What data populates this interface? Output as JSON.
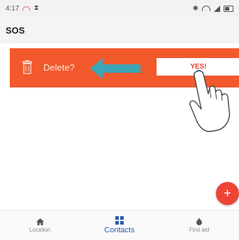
{
  "status_bar": {
    "time": "4:17",
    "icons": [
      "wifi-icon",
      "hourglass-icon",
      "bluetooth-icon",
      "signal-icon",
      "battery-icon"
    ]
  },
  "app_bar": {
    "title": "SOS"
  },
  "delete_row": {
    "label": "Delete?",
    "confirm_label": "YES!",
    "background_color": "#f2592c"
  },
  "fab": {
    "label": "+",
    "color": "#ee4438"
  },
  "bottom_nav": {
    "items": [
      {
        "label": "Location",
        "icon": "home-icon",
        "active": false
      },
      {
        "label": "Contacts",
        "icon": "contacts-grid-icon",
        "active": true
      },
      {
        "label": "First aid",
        "icon": "first-aid-icon",
        "active": false
      }
    ]
  },
  "colors": {
    "accent": "#2a5aa8",
    "arrow": "#3aa6b8"
  }
}
